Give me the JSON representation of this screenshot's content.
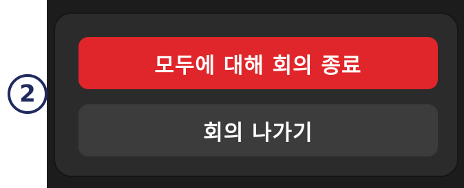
{
  "dialog": {
    "end_for_all_label": "모두에 대해 회의 종료",
    "leave_label": "회의 나가기"
  },
  "annotation": {
    "step_number": "2"
  },
  "colors": {
    "end_button": "#e0262a",
    "leave_button": "#3c3c3c",
    "panel": "#2b2b2b",
    "badge": "#1f2b5e"
  }
}
